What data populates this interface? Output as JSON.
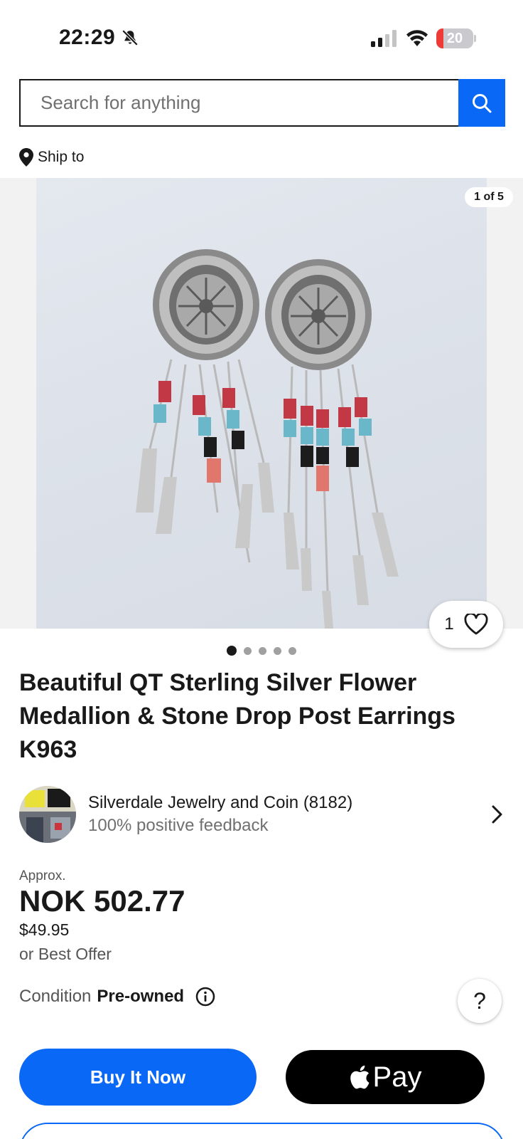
{
  "status_bar": {
    "time": "22:29",
    "battery_level": 20,
    "battery_label": "20",
    "icons": [
      "bell-slash-icon",
      "signal-icon",
      "wifi-icon",
      "battery-icon"
    ]
  },
  "search": {
    "placeholder": "Search for anything",
    "value": ""
  },
  "ship_to": {
    "label": "Ship to"
  },
  "gallery": {
    "counter": "1 of 5",
    "total_images": 5,
    "active_index": 1,
    "watch_count": "1"
  },
  "listing": {
    "title": "Beautiful QT Sterling Silver Flower Medallion & Stone Drop Post Earrings K963"
  },
  "seller": {
    "name": "Silverdale Jewelry and Coin (8182)",
    "feedback": "100% positive feedback"
  },
  "price": {
    "approx_label": "Approx.",
    "converted": "NOK 502.77",
    "original": "$49.95",
    "best_offer": "or Best Offer"
  },
  "condition": {
    "label": "Condition",
    "value": "Pre-owned"
  },
  "help": {
    "label": "?"
  },
  "actions": {
    "buy_now": "Buy It Now",
    "apple_pay": "Pay"
  },
  "colors": {
    "accent_blue": "#0968f6",
    "text": "#191919",
    "muted": "#707070",
    "battery_red": "#ee3b36"
  }
}
